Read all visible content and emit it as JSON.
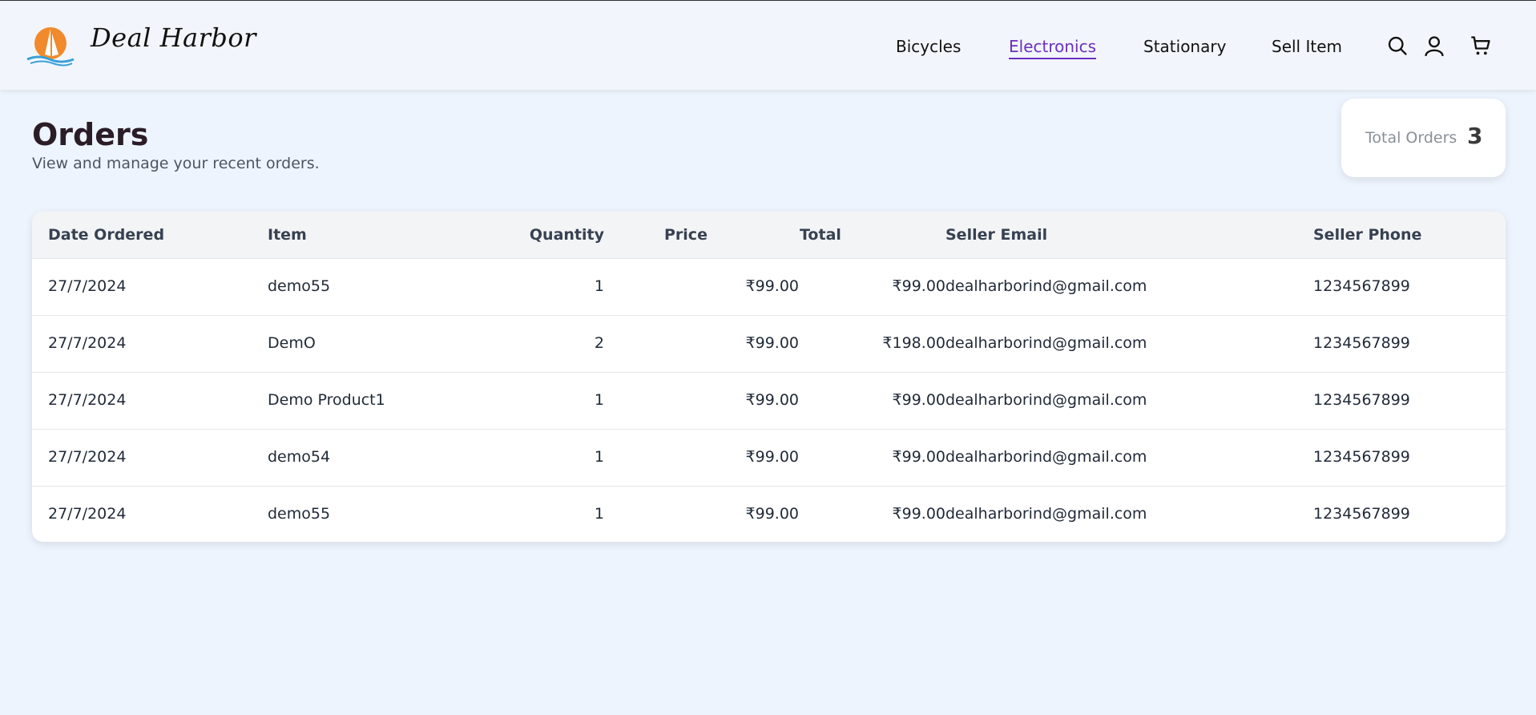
{
  "brand": {
    "name": "Deal Harbor"
  },
  "nav": {
    "items": [
      {
        "label": "Bicycles"
      },
      {
        "label": "Electronics",
        "active": true
      },
      {
        "label": "Stationary"
      },
      {
        "label": "Sell Item"
      }
    ],
    "icons": [
      "search-icon",
      "user-icon",
      "cart-icon"
    ]
  },
  "page": {
    "title": "Orders",
    "subtitle": "View and manage your recent orders."
  },
  "summary": {
    "label": "Total Orders",
    "value": "3"
  },
  "table": {
    "headers": [
      "Date Ordered",
      "Item",
      "Quantity",
      "Price",
      "Total",
      "Seller Email",
      "Seller Phone"
    ],
    "rows": [
      [
        "27/7/2024",
        "demo55",
        "1",
        "₹99.00",
        "₹99.00",
        "dealharborind@gmail.com",
        "1234567899"
      ],
      [
        "27/7/2024",
        "DemO",
        "2",
        "₹99.00",
        "₹198.00",
        "dealharborind@gmail.com",
        "1234567899"
      ],
      [
        "27/7/2024",
        "Demo Product1",
        "1",
        "₹99.00",
        "₹99.00",
        "dealharborind@gmail.com",
        "1234567899"
      ],
      [
        "27/7/2024",
        "demo54",
        "1",
        "₹99.00",
        "₹99.00",
        "dealharborind@gmail.com",
        "1234567899"
      ],
      [
        "27/7/2024",
        "demo55",
        "1",
        "₹99.00",
        "₹99.00",
        "dealharborind@gmail.com",
        "1234567899"
      ]
    ]
  },
  "colors": {
    "accent": "#6b2fbf",
    "background": "#eef4fd",
    "logo_sun": "#f08a2c",
    "logo_wave": "#3aa0d8"
  }
}
